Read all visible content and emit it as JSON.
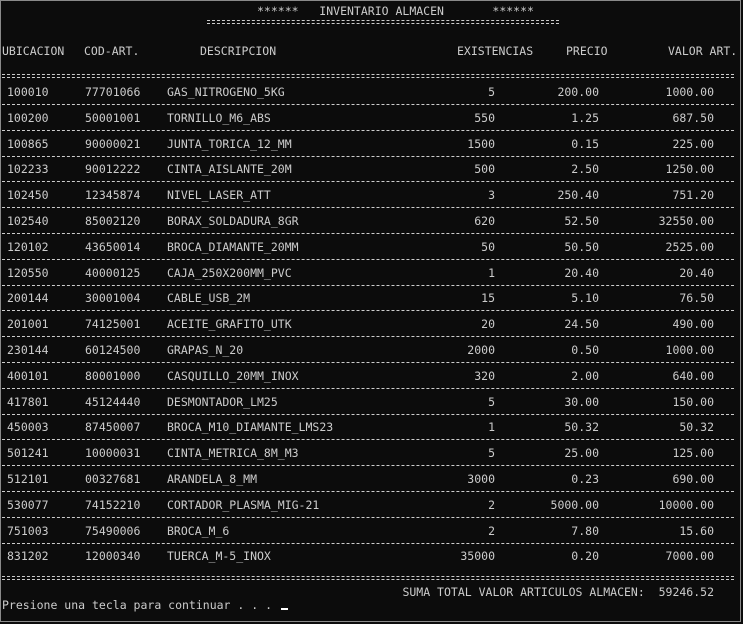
{
  "title": "******   INVENTARIO ALMACEN       ******",
  "headers": {
    "ubicacion": "UBICACION",
    "cod_art": "COD-ART.",
    "descripcion": "DESCRIPCION",
    "existencias": "EXISTENCIAS",
    "precio": "PRECIO",
    "valor_art": "VALOR ART."
  },
  "rows": [
    {
      "ubicacion": "100010",
      "cod_art": "77701066",
      "descripcion": "GAS_NITROGENO_5KG",
      "existencias": "5",
      "precio": "200.00",
      "valor": "1000.00"
    },
    {
      "ubicacion": "100200",
      "cod_art": "50001001",
      "descripcion": "TORNILLO_M6_ABS",
      "existencias": "550",
      "precio": "1.25",
      "valor": "687.50"
    },
    {
      "ubicacion": "100865",
      "cod_art": "90000021",
      "descripcion": "JUNTA_TORICA_12_MM",
      "existencias": "1500",
      "precio": "0.15",
      "valor": "225.00"
    },
    {
      "ubicacion": "102233",
      "cod_art": "90012222",
      "descripcion": "CINTA_AISLANTE_20M",
      "existencias": "500",
      "precio": "2.50",
      "valor": "1250.00"
    },
    {
      "ubicacion": "102450",
      "cod_art": "12345874",
      "descripcion": "NIVEL_LASER_ATT",
      "existencias": "3",
      "precio": "250.40",
      "valor": "751.20"
    },
    {
      "ubicacion": "102540",
      "cod_art": "85002120",
      "descripcion": "BORAX_SOLDADURA_8GR",
      "existencias": "620",
      "precio": "52.50",
      "valor": "32550.00"
    },
    {
      "ubicacion": "120102",
      "cod_art": "43650014",
      "descripcion": "BROCA_DIAMANTE_20MM",
      "existencias": "50",
      "precio": "50.50",
      "valor": "2525.00"
    },
    {
      "ubicacion": "120550",
      "cod_art": "40000125",
      "descripcion": "CAJA_250X200MM_PVC",
      "existencias": "1",
      "precio": "20.40",
      "valor": "20.40"
    },
    {
      "ubicacion": "200144",
      "cod_art": "30001004",
      "descripcion": "CABLE_USB_2M",
      "existencias": "15",
      "precio": "5.10",
      "valor": "76.50"
    },
    {
      "ubicacion": "201001",
      "cod_art": "74125001",
      "descripcion": "ACEITE_GRAFITO_UTK",
      "existencias": "20",
      "precio": "24.50",
      "valor": "490.00"
    },
    {
      "ubicacion": "230144",
      "cod_art": "60124500",
      "descripcion": "GRAPAS_N_20",
      "existencias": "2000",
      "precio": "0.50",
      "valor": "1000.00"
    },
    {
      "ubicacion": "400101",
      "cod_art": "80001000",
      "descripcion": "CASQUILLO_20MM_INOX",
      "existencias": "320",
      "precio": "2.00",
      "valor": "640.00"
    },
    {
      "ubicacion": "417801",
      "cod_art": "45124440",
      "descripcion": "DESMONTADOR_LM25",
      "existencias": "5",
      "precio": "30.00",
      "valor": "150.00"
    },
    {
      "ubicacion": "450003",
      "cod_art": "87450007",
      "descripcion": "BROCA_M10_DIAMANTE_LMS23",
      "existencias": "1",
      "precio": "50.32",
      "valor": "50.32"
    },
    {
      "ubicacion": "501241",
      "cod_art": "10000031",
      "descripcion": "CINTA_METRICA_8M_M3",
      "existencias": "5",
      "precio": "25.00",
      "valor": "125.00"
    },
    {
      "ubicacion": "512101",
      "cod_art": "00327681",
      "descripcion": "ARANDELA_8_MM",
      "existencias": "3000",
      "precio": "0.23",
      "valor": "690.00"
    },
    {
      "ubicacion": "530077",
      "cod_art": "74152210",
      "descripcion": "CORTADOR_PLASMA_MIG-21",
      "existencias": "2",
      "precio": "5000.00",
      "valor": "10000.00"
    },
    {
      "ubicacion": "751003",
      "cod_art": "75490006",
      "descripcion": "BROCA_M_6",
      "existencias": "2",
      "precio": "7.80",
      "valor": "15.60"
    },
    {
      "ubicacion": "831202",
      "cod_art": "12000340",
      "descripcion": "TUERCA_M-5_INOX",
      "existencias": "35000",
      "precio": "0.20",
      "valor": "7000.00"
    }
  ],
  "total_line": "SUMA TOTAL VALOR ARTICULOS ALMACEN:  59246.52",
  "prompt": "Presione una tecla para continuar . . . "
}
